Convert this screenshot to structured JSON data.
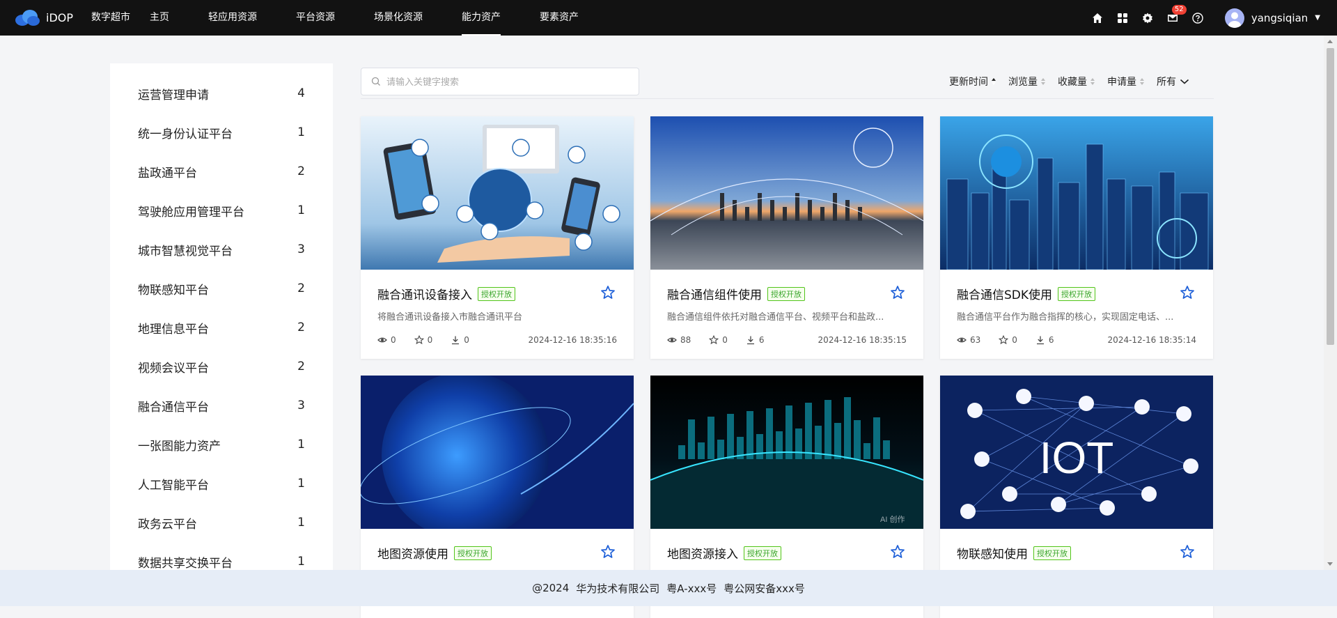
{
  "header": {
    "logo_text": "iDOP",
    "nav": [
      {
        "label": "数字超市"
      },
      {
        "label": "主页"
      },
      {
        "label": "轻应用资源"
      },
      {
        "label": "平台资源"
      },
      {
        "label": "场景化资源"
      },
      {
        "label": "能力资产",
        "active": true
      },
      {
        "label": "要素资产"
      }
    ],
    "mail_badge": "52",
    "username": "yangsiqian",
    "icons": [
      "home-icon",
      "apps-icon",
      "settings-icon",
      "mail-icon",
      "help-icon"
    ]
  },
  "sidebar": {
    "items": [
      {
        "label": "运营管理申请",
        "count": "4"
      },
      {
        "label": "统一身份认证平台",
        "count": "1"
      },
      {
        "label": "盐政通平台",
        "count": "2"
      },
      {
        "label": "驾驶舱应用管理平台",
        "count": "1"
      },
      {
        "label": "城市智慧视觉平台",
        "count": "3"
      },
      {
        "label": "物联感知平台",
        "count": "2"
      },
      {
        "label": "地理信息平台",
        "count": "2"
      },
      {
        "label": "视频会议平台",
        "count": "2"
      },
      {
        "label": "融合通信平台",
        "count": "3"
      },
      {
        "label": "一张图能力资产",
        "count": "1"
      },
      {
        "label": "人工智能平台",
        "count": "1"
      },
      {
        "label": "政务云平台",
        "count": "1"
      },
      {
        "label": "数据共享交换平台",
        "count": "1"
      }
    ]
  },
  "search": {
    "placeholder": "请输入关键字搜索",
    "value": ""
  },
  "sort": {
    "options": [
      {
        "label": "更新时间",
        "active": true
      },
      {
        "label": "浏览量"
      },
      {
        "label": "收藏量"
      },
      {
        "label": "申请量"
      }
    ],
    "filter_label": "所有"
  },
  "cards": [
    {
      "title": "融合通讯设备接入",
      "tag": "授权开放",
      "desc": "将融合通讯设备接入市融合通讯平台",
      "views": "0",
      "stars": "0",
      "downloads": "0",
      "date": "2024-12-16 18:35:16",
      "image": "devices-network"
    },
    {
      "title": "融合通信组件使用",
      "tag": "授权开放",
      "desc": "融合通信组件依托对融合通信平台、视频平台和盐政...",
      "views": "88",
      "stars": "0",
      "downloads": "6",
      "date": "2024-12-16 18:35:15",
      "image": "industrial-network"
    },
    {
      "title": "融合通信SDK使用",
      "tag": "授权开放",
      "desc": "融合通信平台作为融合指挥的核心，实现固定电话、...",
      "views": "63",
      "stars": "0",
      "downloads": "6",
      "date": "2024-12-16 18:35:14",
      "image": "smart-city"
    },
    {
      "title": "地图资源使用",
      "tag": "授权开放",
      "desc": "",
      "views": "",
      "stars": "",
      "downloads": "",
      "date": "",
      "image": "globe"
    },
    {
      "title": "地图资源接入",
      "tag": "授权开放",
      "desc": "",
      "views": "",
      "stars": "",
      "downloads": "",
      "date": "",
      "image": "city-glow",
      "watermark": "AI 创作"
    },
    {
      "title": "物联感知使用",
      "tag": "授权开放",
      "desc": "",
      "views": "",
      "stars": "",
      "downloads": "",
      "date": "",
      "image": "iot",
      "image_text": "IOT"
    }
  ],
  "footer": {
    "copyright": "@2024",
    "company": "华为技术有限公司",
    "icp": "粤A-xxx号",
    "police": "粤公网安备xxx号"
  },
  "colors": {
    "header_bg": "#121212",
    "tag_green": "#52c41a",
    "star_blue": "#1d5fd8",
    "footer_bg": "#e6edf7"
  }
}
